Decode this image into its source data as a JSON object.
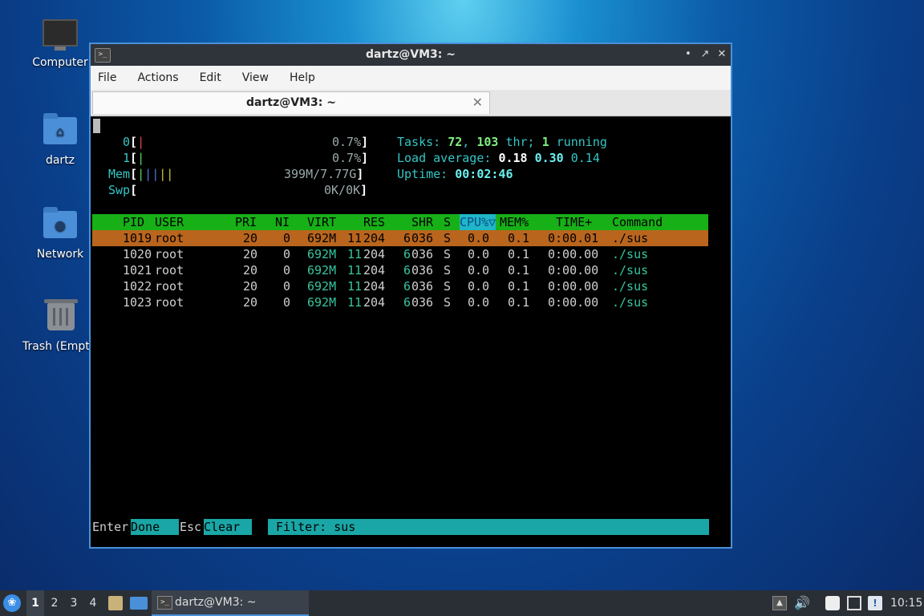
{
  "desktop": {
    "icons": [
      {
        "label": "Computer"
      },
      {
        "label": "dartz"
      },
      {
        "label": "Network"
      },
      {
        "label": "Trash (Empt"
      }
    ]
  },
  "window": {
    "title": "dartz@VM3: ~",
    "app_icon": ">_",
    "buttons": {
      "minimize": "•",
      "maximize": "↗",
      "close": "✕"
    },
    "menu": [
      "File",
      "Actions",
      "Edit",
      "View",
      "Help"
    ],
    "tab": {
      "label": "dartz@VM3: ~",
      "close": "✕"
    }
  },
  "htop": {
    "cpu0": {
      "label": "0",
      "percent": "0.7%"
    },
    "cpu1": {
      "label": "1",
      "percent": "0.7%"
    },
    "mem": {
      "label": "Mem",
      "value": "399M/7.77G"
    },
    "swp": {
      "label": "Swp",
      "value": "0K/0K"
    },
    "tasks": {
      "label": "Tasks:",
      "count": "72",
      "threads": "103",
      "thr_label": "thr;",
      "running": "1",
      "running_label": "running"
    },
    "load": {
      "label": "Load average:",
      "one": "0.18",
      "five": "0.30",
      "fifteen": "0.14"
    },
    "uptime": {
      "label": "Uptime:",
      "value": "00:02:46"
    },
    "columns": {
      "pid": "PID",
      "user": "USER",
      "pri": "PRI",
      "ni": "NI",
      "virt": "VIRT",
      "res": "RES",
      "shr": "SHR",
      "s": "S",
      "cpu": "CPU%▽",
      "mem": "MEM%",
      "time": "TIME+",
      "command": "Command"
    },
    "processes": [
      {
        "pid": "1019",
        "user": "root",
        "pri": "20",
        "ni": "0",
        "virt": "692M",
        "res_a": "11",
        "res_b": "204",
        "shr_a": "6",
        "shr_b": "036",
        "s": "S",
        "cpu": "0.0",
        "mem": "0.1",
        "time": "0:00.01",
        "command": "./sus"
      },
      {
        "pid": "1020",
        "user": "root",
        "pri": "20",
        "ni": "0",
        "virt": "692M",
        "res_a": "11",
        "res_b": "204",
        "shr_a": "6",
        "shr_b": "036",
        "s": "S",
        "cpu": "0.0",
        "mem": "0.1",
        "time": "0:00.00",
        "command": "./sus"
      },
      {
        "pid": "1021",
        "user": "root",
        "pri": "20",
        "ni": "0",
        "virt": "692M",
        "res_a": "11",
        "res_b": "204",
        "shr_a": "6",
        "shr_b": "036",
        "s": "S",
        "cpu": "0.0",
        "mem": "0.1",
        "time": "0:00.00",
        "command": "./sus"
      },
      {
        "pid": "1022",
        "user": "root",
        "pri": "20",
        "ni": "0",
        "virt": "692M",
        "res_a": "11",
        "res_b": "204",
        "shr_a": "6",
        "shr_b": "036",
        "s": "S",
        "cpu": "0.0",
        "mem": "0.1",
        "time": "0:00.00",
        "command": "./sus"
      },
      {
        "pid": "1023",
        "user": "root",
        "pri": "20",
        "ni": "0",
        "virt": "692M",
        "res_a": "11",
        "res_b": "204",
        "shr_a": "6",
        "shr_b": "036",
        "s": "S",
        "cpu": "0.0",
        "mem": "0.1",
        "time": "0:00.00",
        "command": "./sus"
      }
    ],
    "footer": {
      "enter_key": "Enter",
      "enter_action": "Done",
      "esc_key": "Esc",
      "esc_action": "Clear",
      "filter_label": "Filter: sus"
    }
  },
  "taskbar": {
    "workspaces": [
      "1",
      "2",
      "3",
      "4"
    ],
    "task_label": "dartz@VM3: ~",
    "clock": "10:15"
  },
  "colors": {
    "window_border": "#4a90d9",
    "header_green": "#17b017",
    "selected_row": "#b9651e",
    "filter_cyan": "#1aa6a6"
  }
}
